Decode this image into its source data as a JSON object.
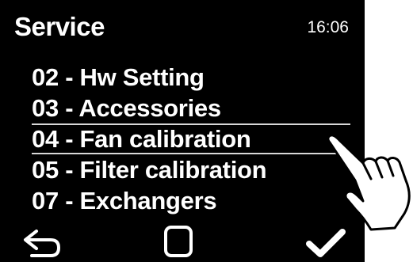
{
  "header": {
    "title": "Service",
    "time": "16:06"
  },
  "menu": {
    "items": [
      {
        "label": "02 - Hw Setting",
        "selected": false
      },
      {
        "label": "03 - Accessories",
        "selected": false
      },
      {
        "label": "04 - Fan calibration",
        "selected": true
      },
      {
        "label": "05 - Filter calibration",
        "selected": false
      },
      {
        "label": "07 - Exchangers",
        "selected": false
      }
    ]
  },
  "softkeys": {
    "back": {
      "icon": "back-arrow-icon"
    },
    "home": {
      "icon": "square-icon"
    },
    "confirm": {
      "icon": "checkmark-icon"
    }
  },
  "colors": {
    "screen_background": "#000000",
    "text": "#ffffff",
    "selection_line": "#d8d8d8"
  }
}
